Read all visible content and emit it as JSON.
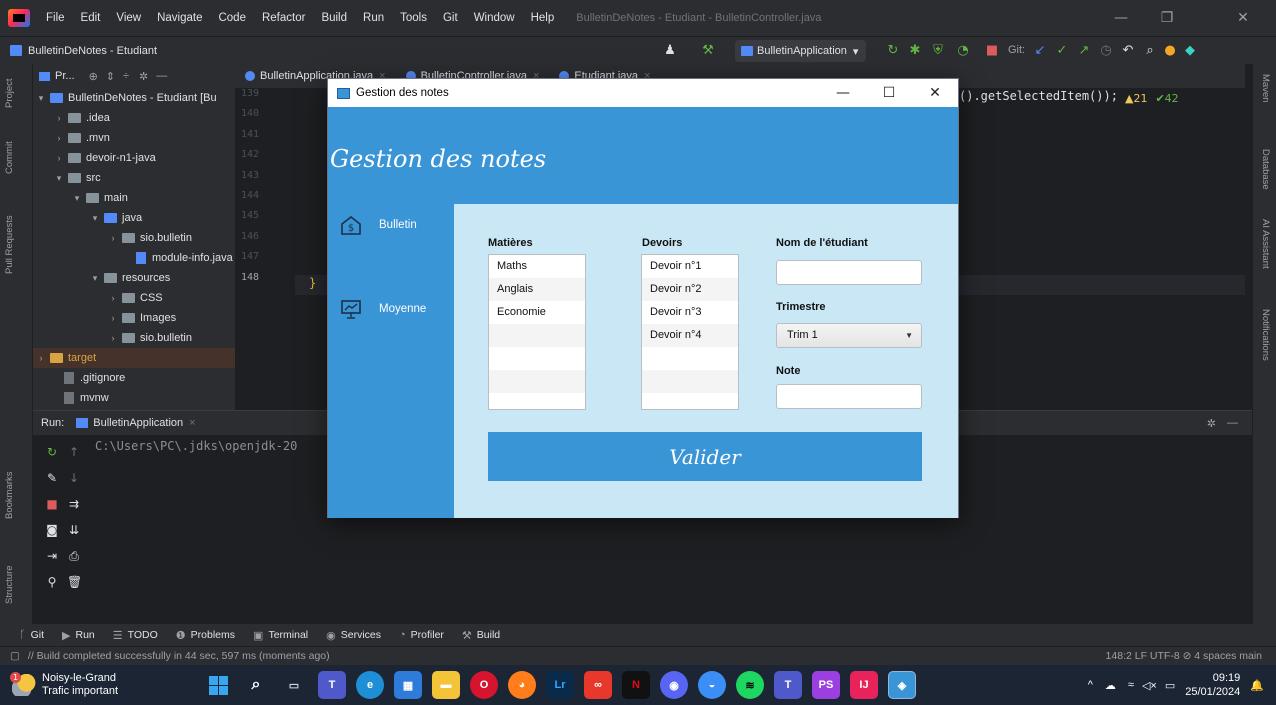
{
  "ide": {
    "menu": [
      "File",
      "Edit",
      "View",
      "Navigate",
      "Code",
      "Refactor",
      "Build",
      "Run",
      "Tools",
      "Git",
      "Window",
      "Help"
    ],
    "window_title": "BulletinDeNotes - Etudiant - BulletinController.java",
    "project_name": "BulletinDeNotes - Etudiant",
    "run_config": "BulletinApplication",
    "git_label": "Git:",
    "project_panel_label": "Pr...",
    "tabs": [
      "BulletinApplication.java",
      "BulletinController.java",
      "Etudiant.java"
    ],
    "tree": [
      {
        "label": "BulletinDeNotes - Etudiant [Bu",
        "chev": "▾"
      },
      {
        "label": ".idea",
        "chev": "›"
      },
      {
        "label": ".mvn",
        "chev": "›"
      },
      {
        "label": "devoir-n1-java",
        "chev": "›"
      },
      {
        "label": "src",
        "chev": "▾"
      },
      {
        "label": "main",
        "chev": "▾"
      },
      {
        "label": "java",
        "chev": "▾"
      },
      {
        "label": "sio.bulletin",
        "chev": "›"
      },
      {
        "label": "module-info.java",
        "chev": ""
      },
      {
        "label": "resources",
        "chev": "▾"
      },
      {
        "label": "CSS",
        "chev": "›"
      },
      {
        "label": "Images",
        "chev": "›"
      },
      {
        "label": "sio.bulletin",
        "chev": "›"
      },
      {
        "label": "target",
        "chev": "›"
      },
      {
        "label": ".gitignore",
        "chev": ""
      },
      {
        "label": "mvnw",
        "chev": ""
      }
    ],
    "line_numbers": [
      "139",
      "140",
      "141",
      "142",
      "143",
      "144",
      "145",
      "146",
      "147",
      "148"
    ],
    "code_fragment": "().getSelectedItem());",
    "brace": "}",
    "warnings": "▲21",
    "weak_warnings": "✔42",
    "left_tools": [
      "Project",
      "Commit",
      "Pull Requests",
      "Bookmarks",
      "Structure"
    ],
    "right_tools": [
      "Maven",
      "Database",
      "AI Assistant",
      "Notifications"
    ],
    "run_label": "Run:",
    "run_tab": "BulletinApplication",
    "console_line": "C:\\Users\\PC\\.jdks\\openjdk-20",
    "toolwindows": [
      "Git",
      "Run",
      "TODO",
      "Problems",
      "Terminal",
      "Services",
      "Profiler",
      "Build"
    ],
    "status_message": "// Build completed successfully in 44 sec, 597 ms (moments ago)",
    "status_right": "148:2  LF  UTF-8  ⊘  4 spaces  main"
  },
  "dialog": {
    "title": "Gestion des notes",
    "heading": "Gestion des notes",
    "nav": [
      {
        "label": "Bulletin",
        "icon": "bulletin-icon"
      },
      {
        "label": "Moyenne",
        "icon": "moyenne-icon"
      }
    ],
    "subjects_header": "Matières",
    "subjects": [
      "Maths",
      "Anglais",
      "Economie"
    ],
    "assignments_header": "Devoirs",
    "assignments": [
      "Devoir n°1",
      "Devoir n°2",
      "Devoir n°3",
      "Devoir n°4"
    ],
    "student_label": "Nom de l'étudiant",
    "student_value": "",
    "trimester_label": "Trimestre",
    "trimester_value": "Trim 1",
    "grade_label": "Note",
    "grade_value": "",
    "validate_label": "Valider"
  },
  "taskbar": {
    "weather_title": "Noisy-le-Grand",
    "weather_sub": "Trafic important",
    "weather_badge": "1",
    "time": "09:19",
    "date": "25/01/2024"
  }
}
